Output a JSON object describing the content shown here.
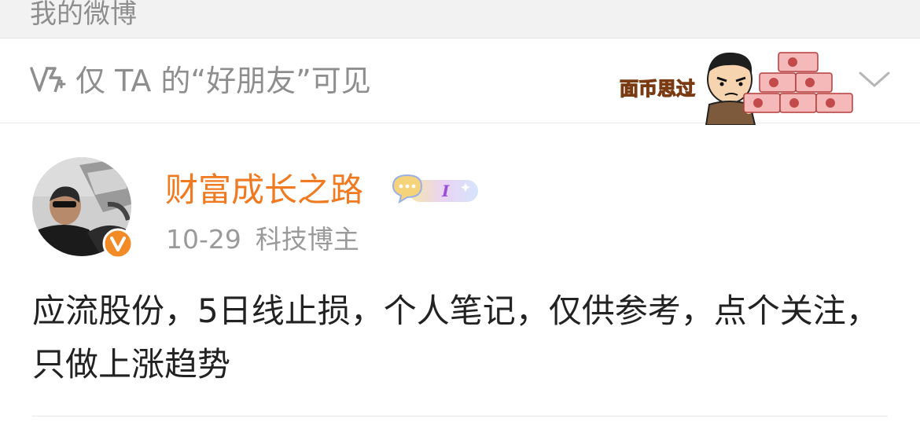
{
  "topbar": {
    "title": "我的微博"
  },
  "visibility": {
    "icon": "visibility-lock-icon",
    "label": "仅 TA 的“好朋友”可见",
    "sticker_text": "面币思过"
  },
  "post": {
    "username": "财富成长之路",
    "badge_text": "I",
    "date": "10-29",
    "author_tag": "科技博主",
    "content": "应流股份，5日线止损，个人笔记，仅供参考，点个关注，只做上涨趋势"
  },
  "colors": {
    "username": "#ef7a21",
    "verified": "#f28a26",
    "secondary_text": "#9a9a9a",
    "sticker_text": "#f4a11f"
  }
}
